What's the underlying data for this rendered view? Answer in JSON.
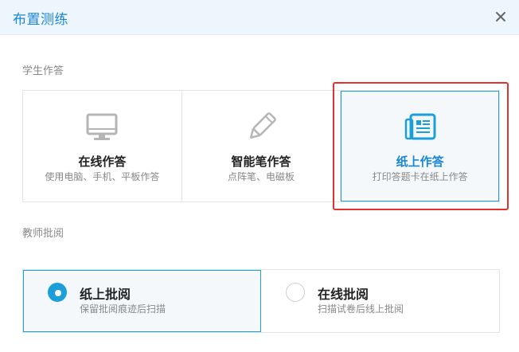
{
  "dialog": {
    "title": "布置测练",
    "close_icon": "close-icon"
  },
  "sections": {
    "student_answer_label": "学生作答",
    "teacher_review_label": "教师批阅"
  },
  "answer_options": [
    {
      "title": "在线作答",
      "desc": "使用电脑、手机、平板作答",
      "icon": "monitor-icon",
      "selected": false
    },
    {
      "title": "智能笔作答",
      "desc": "点阵笔、电磁板",
      "icon": "pen-icon",
      "selected": false
    },
    {
      "title": "纸上作答",
      "desc": "打印答题卡在纸上作答",
      "icon": "newspaper-icon",
      "selected": true
    }
  ],
  "review_options": [
    {
      "title": "纸上批阅",
      "desc": "保留批阅痕迹后扫描",
      "selected": true
    },
    {
      "title": "在线批阅",
      "desc": "扫描试卷后线上批阅",
      "selected": false
    }
  ],
  "colors": {
    "accent": "#1a9fd9",
    "title_blue": "#1a86d8",
    "highlight_red": "#e0332f",
    "header_bg": "#eef6fd"
  }
}
